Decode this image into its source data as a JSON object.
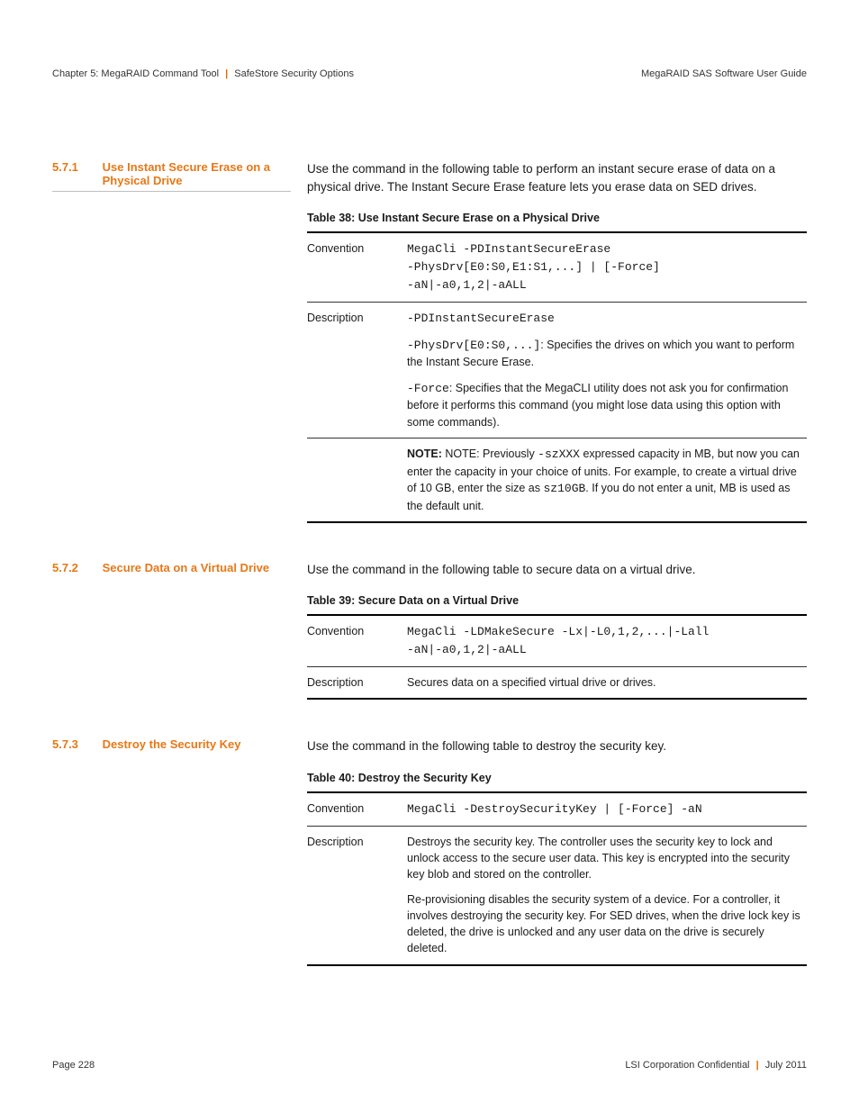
{
  "header": {
    "left_chapter": "Chapter 5: MegaRAID Command Tool",
    "left_section": "SafeStore Security Options",
    "right": "MegaRAID SAS Software User Guide"
  },
  "sections": [
    {
      "num": "5.7.1",
      "title": "Use Instant Secure Erase on a Physical Drive",
      "underline": true,
      "intro": "Use the command in the following table to perform an instant secure erase of data on a physical drive. The Instant Secure Erase feature lets you erase data on SED drives.",
      "table_caption": "Table 38:   Use Instant Secure Erase on a Physical Drive",
      "rows": {
        "convention_cmd": "MegaCli -PDInstantSecureErase \n-PhysDrv[E0:S0,E1:S1,...] | [-Force] \n-aN|-a0,1,2|-aALL",
        "desc_cmd1": "-PDInstantSecureErase",
        "desc_para2_pre": "-PhysDrv[E0:S0,...]",
        "desc_para2_post": ": Specifies the drives on which you want to perform the Instant Secure Erase.",
        "desc_para3_pre": "-Force",
        "desc_para3_post": ": Specifies that the MegaCLI utility does not ask you for confirmation before it performs this command (you might lose data using this option with some commands).",
        "note_label": "NOTE: ",
        "note1": "NOTE: Previously ",
        "note_code1": "-szXXX",
        "note2": " expressed capacity in MB, but now you can enter the capacity in your choice of units. For example, to create a virtual drive of 10 GB, enter the size as ",
        "note_code2": "sz10GB",
        "note3": ". If you do not enter a unit, MB is used as the default unit."
      }
    },
    {
      "num": "5.7.2",
      "title": "Secure Data on a Virtual Drive",
      "underline": false,
      "intro": "Use the command in the following table to secure data on a virtual drive.",
      "table_caption": "Table 39:   Secure Data on a Virtual Drive",
      "rows": {
        "convention_cmd": "MegaCli -LDMakeSecure -Lx|-L0,1,2,...|-Lall \n-aN|-a0,1,2|-aALL",
        "desc": "Secures data on a specified virtual drive or drives."
      }
    },
    {
      "num": "5.7.3",
      "title": "Destroy the Security Key",
      "underline": false,
      "intro": "Use the command in the following table to destroy the security key.",
      "table_caption": "Table 40:   Destroy the Security Key",
      "rows": {
        "convention_cmd": "MegaCli -DestroySecurityKey | [-Force] -aN",
        "desc1": "Destroys the security key. The controller uses the security key to lock and unlock access to the secure user data. This key is encrypted into the security key blob and stored on the controller.",
        "desc2": "Re-provisioning disables the security system of a device. For a controller, it involves destroying the security key. For SED drives, when the drive lock key is deleted, the drive is unlocked and any user data on the drive is securely deleted."
      }
    }
  ],
  "labels": {
    "convention": "Convention",
    "description": "Description"
  },
  "footer": {
    "page": "Page 228",
    "right_left": "LSI Corporation Confidential",
    "right_right": "July 2011"
  }
}
